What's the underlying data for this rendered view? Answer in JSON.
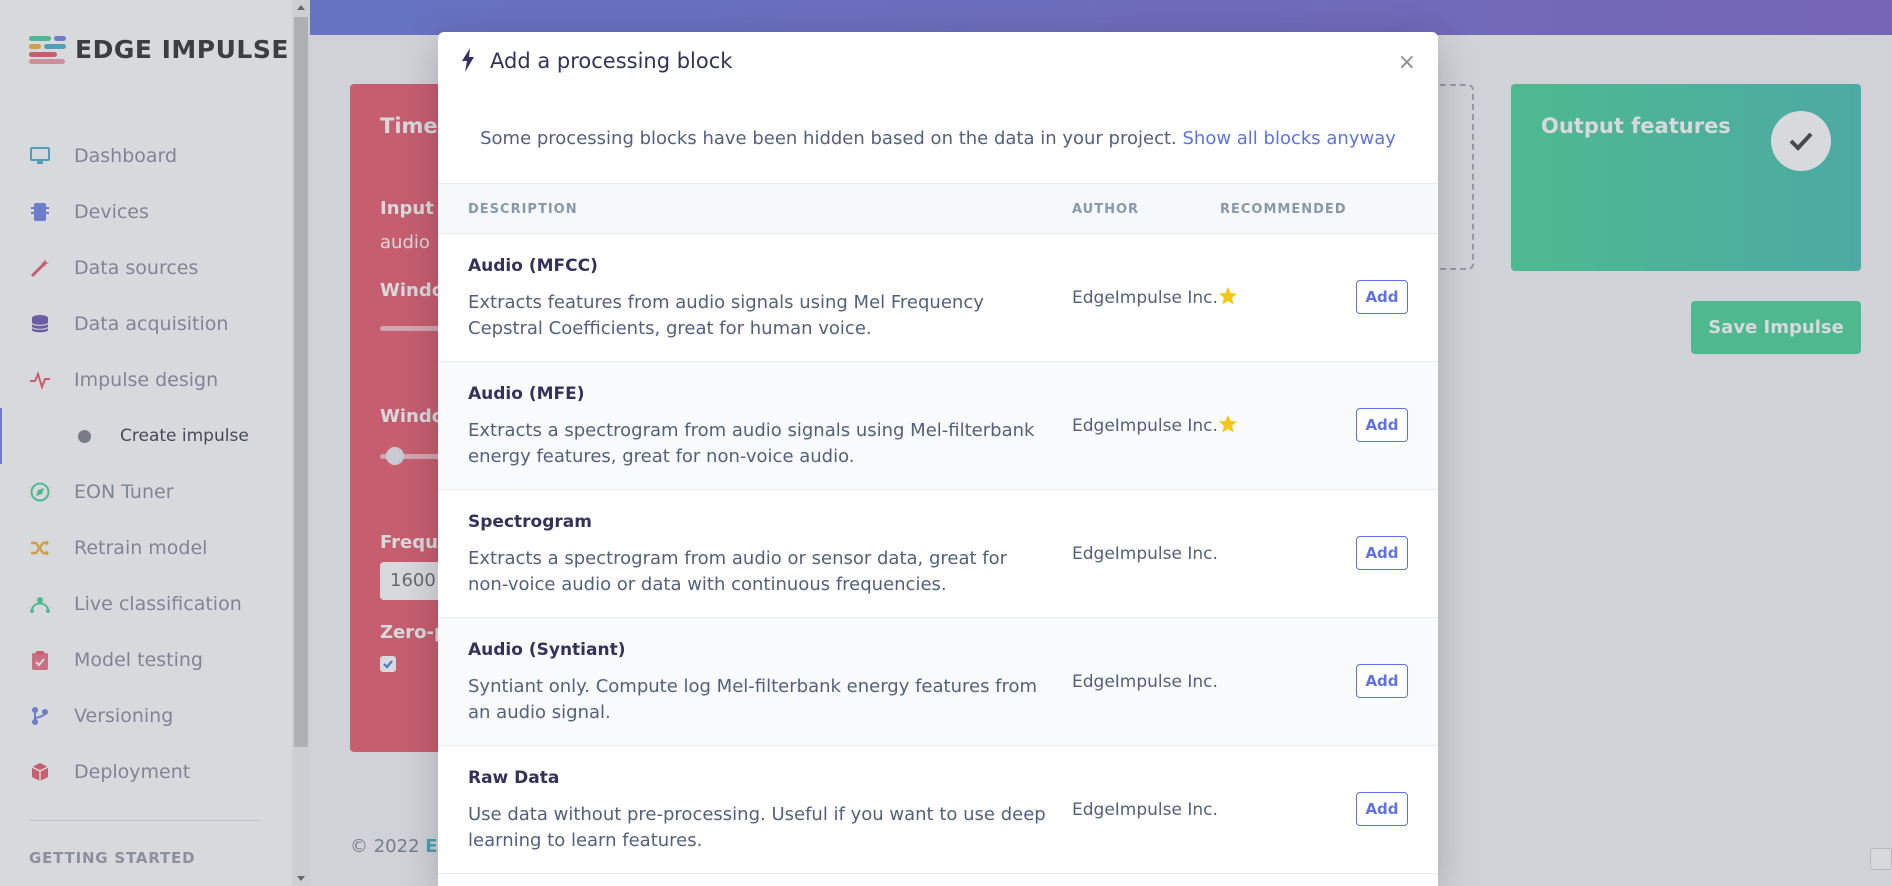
{
  "app": {
    "name": "EDGE IMPULSE"
  },
  "sidebar": {
    "items": [
      {
        "label": "Dashboard",
        "icon": "monitor-icon",
        "color": "#2ca8c8"
      },
      {
        "label": "Devices",
        "icon": "chip-icon",
        "color": "#5e72e4"
      },
      {
        "label": "Data sources",
        "icon": "wand-icon",
        "color": "#e5425a"
      },
      {
        "label": "Data acquisition",
        "icon": "database-icon",
        "color": "#5a3fa8"
      },
      {
        "label": "Impulse design",
        "icon": "pulse-icon",
        "color": "#e5425a"
      },
      {
        "label": "Create impulse",
        "sub": true
      },
      {
        "label": "EON Tuner",
        "icon": "compass-icon",
        "color": "#2dce89"
      },
      {
        "label": "Retrain model",
        "icon": "shuffle-icon",
        "color": "#f5a623"
      },
      {
        "label": "Live classification",
        "icon": "network-icon",
        "color": "#2dce89"
      },
      {
        "label": "Model testing",
        "icon": "clipboard-check-icon",
        "color": "#e5425a"
      },
      {
        "label": "Versioning",
        "icon": "branch-icon",
        "color": "#5e72e4"
      },
      {
        "label": "Deployment",
        "icon": "box-icon",
        "color": "#e5425a"
      }
    ],
    "section_label": "GETTING STARTED"
  },
  "background": {
    "time_card": {
      "title": "Time s",
      "input_label": "Input a",
      "input_value": "audio",
      "window_label_1": "Windo",
      "window_label_2": "Windo",
      "frequency_label": "Freque",
      "frequency_value": "1600",
      "zero_pad_label": "Zero-pa"
    },
    "output_card": {
      "title": "Output features"
    },
    "save_button": "Save Impulse",
    "footer": {
      "copyright": "© 2022",
      "link": "Ed"
    }
  },
  "modal": {
    "title": "Add a processing block",
    "close": "×",
    "notice": "Some processing blocks have been hidden based on the data in your project.",
    "notice_link": "Show all blocks anyway",
    "columns": {
      "description": "DESCRIPTION",
      "author": "AUTHOR",
      "recommended": "RECOMMENDED"
    },
    "add_label": "Add",
    "blocks": [
      {
        "name": "Audio (MFCC)",
        "description": "Extracts features from audio signals using Mel Frequency Cepstral Coefficients, great for human voice.",
        "author": "EdgeImpulse Inc.",
        "recommended": true
      },
      {
        "name": "Audio (MFE)",
        "description": "Extracts a spectrogram from audio signals using Mel-filterbank energy features, great for non-voice audio.",
        "author": "EdgeImpulse Inc.",
        "recommended": true
      },
      {
        "name": "Spectrogram",
        "description": "Extracts a spectrogram from audio or sensor data, great for non-voice audio or data with continuous frequencies.",
        "author": "EdgeImpulse Inc.",
        "recommended": false
      },
      {
        "name": "Audio (Syntiant)",
        "description": "Syntiant only. Compute log Mel-filterbank energy features from an audio signal.",
        "author": "EdgeImpulse Inc.",
        "recommended": false
      },
      {
        "name": "Raw Data",
        "description": "Use data without pre-processing. Useful if you want to use deep learning to learn features.",
        "author": "EdgeImpulse Inc.",
        "recommended": false
      }
    ]
  },
  "colors": {
    "accent": "#5e72e4",
    "star": "#f5c518",
    "red_card": "#e5425a",
    "green_card": "#2dce89"
  }
}
